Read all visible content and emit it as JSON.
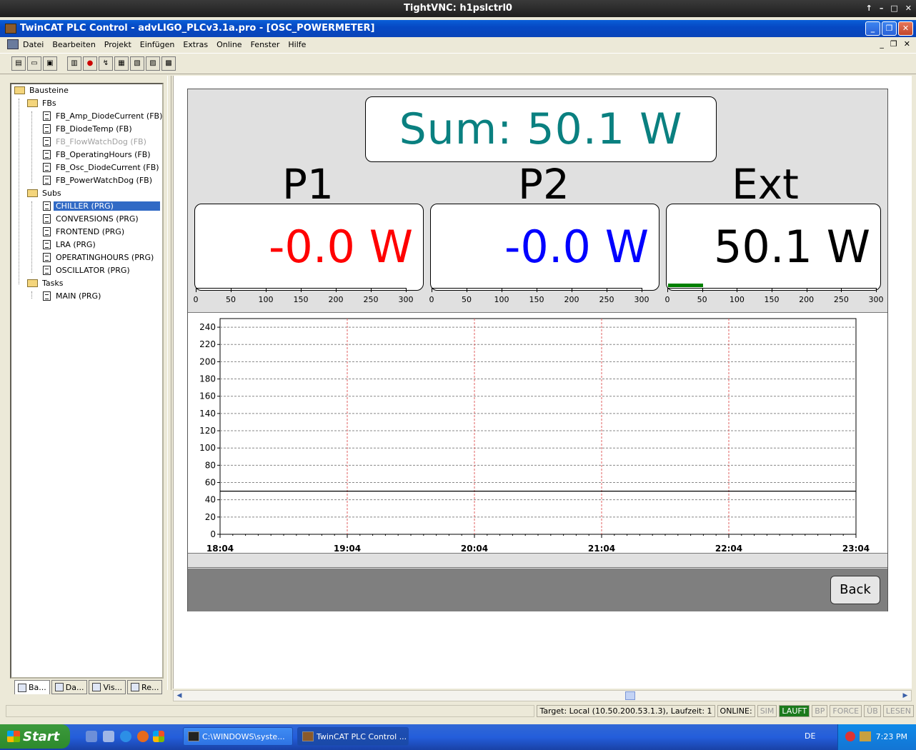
{
  "vnc": {
    "title": "TightVNC: h1pslctrl0",
    "controls": [
      "↑",
      "–",
      "□",
      "✕"
    ]
  },
  "window": {
    "title": "TwinCAT PLC Control - advLIGO_PLCv3.1a.pro - [OSC_POWERMETER]"
  },
  "menu": [
    "Datei",
    "Bearbeiten",
    "Projekt",
    "Einfügen",
    "Extras",
    "Online",
    "Fenster",
    "Hilfe"
  ],
  "mdi_controls": [
    "_",
    "❐",
    "✕"
  ],
  "toolbar_icons": [
    "new-file-icon",
    "open-folder-icon",
    "save-icon",
    "download-icon",
    "stop-icon",
    "step-icon",
    "breakpoint-icon",
    "login-icon",
    "logout-icon",
    "build-icon"
  ],
  "tree": {
    "root": "Bausteine",
    "fbs_label": "FBs",
    "fbs": [
      {
        "label": "FB_Amp_DiodeCurrent (FB)",
        "disabled": false
      },
      {
        "label": "FB_DiodeTemp (FB)",
        "disabled": false
      },
      {
        "label": "FB_FlowWatchDog (FB)",
        "disabled": true
      },
      {
        "label": "FB_OperatingHours (FB)",
        "disabled": false
      },
      {
        "label": "FB_Osc_DiodeCurrent (FB)",
        "disabled": false
      },
      {
        "label": "FB_PowerWatchDog (FB)",
        "disabled": false
      }
    ],
    "subs_label": "Subs",
    "subs": [
      {
        "label": "CHILLER (PRG)",
        "selected": true
      },
      {
        "label": "CONVERSIONS (PRG)",
        "selected": false
      },
      {
        "label": "FRONTEND (PRG)",
        "selected": false
      },
      {
        "label": "LRA (PRG)",
        "selected": false
      },
      {
        "label": "OPERATINGHOURS (PRG)",
        "selected": false
      },
      {
        "label": "OSCILLATOR (PRG)",
        "selected": false
      }
    ],
    "tasks_label": "Tasks",
    "tasks": [
      {
        "label": "MAIN (PRG)"
      }
    ]
  },
  "tabs": [
    "Ba...",
    "Da...",
    "Vis...",
    "Re..."
  ],
  "powermeter": {
    "sum_text": "Sum:  50.1 W",
    "channels": [
      {
        "label": "P1",
        "value_text": "-0.0 W",
        "color": "#ff0000",
        "value": -0.0
      },
      {
        "label": "P2",
        "value_text": "-0.0 W",
        "color": "#0000ff",
        "value": -0.0
      },
      {
        "label": "Ext",
        "value_text": "50.1 W",
        "color": "#000000",
        "value": 50.1
      }
    ],
    "scale_max": 300,
    "scale_ticks": [
      "0",
      "50",
      "100",
      "150",
      "200",
      "250",
      "300"
    ],
    "back_label": "Back"
  },
  "chart_data": {
    "type": "line",
    "x_ticks": [
      "18:04",
      "19:04",
      "20:04",
      "21:04",
      "22:04",
      "23:04"
    ],
    "y_ticks": [
      0,
      20,
      40,
      60,
      80,
      100,
      120,
      140,
      160,
      180,
      200,
      220,
      240
    ],
    "ylim": [
      0,
      250
    ],
    "grid": true,
    "series": [
      {
        "x": [
          "18:04",
          "23:04"
        ],
        "y": [
          50,
          50
        ],
        "color": "#000000"
      }
    ]
  },
  "statusbar": {
    "target": "Target: Local (10.50.200.53.1.3), Laufzeit: 1",
    "online": "ONLINE:",
    "flags": [
      {
        "label": "SIM",
        "state": "dim"
      },
      {
        "label": "LAUFT",
        "state": "green"
      },
      {
        "label": "BP",
        "state": "dim"
      },
      {
        "label": "FORCE",
        "state": "dim"
      },
      {
        "label": "ÜB",
        "state": "dim"
      },
      {
        "label": "LESEN",
        "state": "dim"
      }
    ]
  },
  "taskbar": {
    "start": "Start",
    "tasks": [
      {
        "label": "C:\\WINDOWS\\syste...",
        "active": false
      },
      {
        "label": "TwinCAT PLC Control ...",
        "active": true
      }
    ],
    "lang": "DE",
    "clock": "7:23 PM"
  }
}
